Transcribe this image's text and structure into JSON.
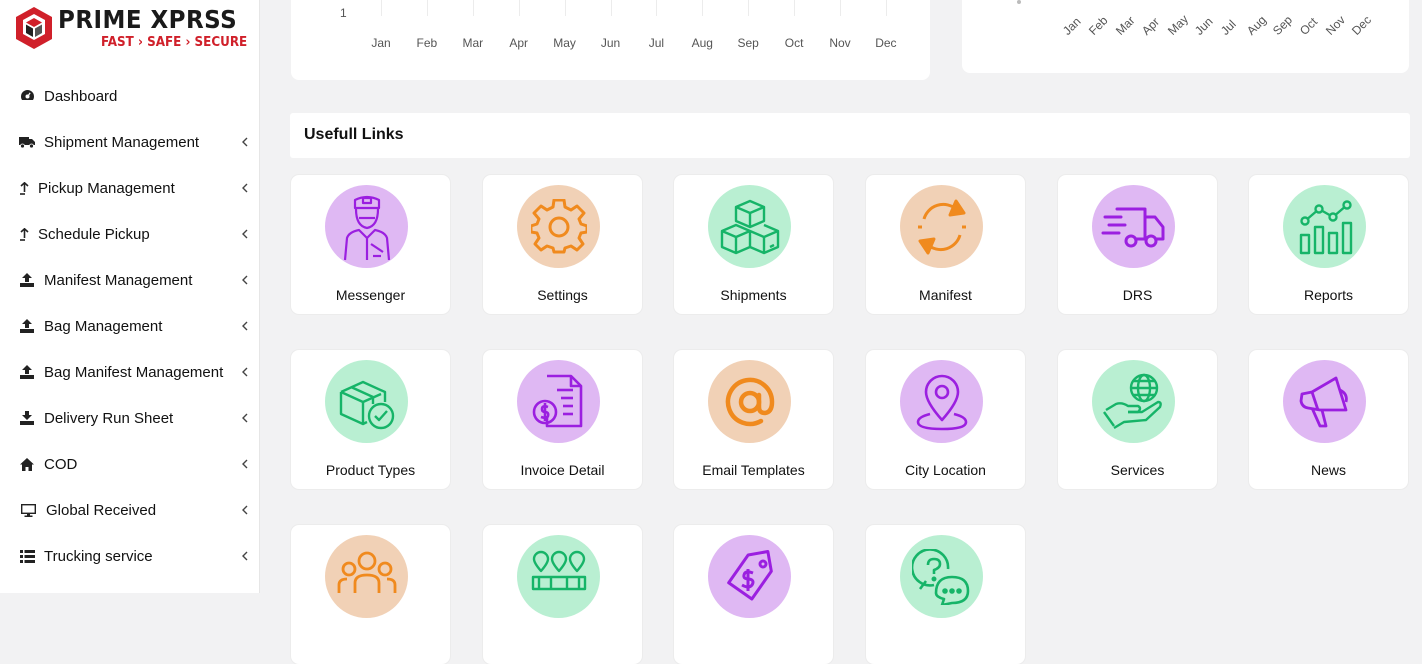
{
  "brand": {
    "name": "PRIME XPRSS",
    "tagline": "FAST › SAFE › SECURE"
  },
  "sidebar": {
    "items": [
      {
        "label": "Dashboard",
        "icon": "dashboard-icon",
        "has_children": false
      },
      {
        "label": "Shipment Management",
        "icon": "truck-icon",
        "has_children": true
      },
      {
        "label": "Pickup Management",
        "icon": "arrow-up-icon",
        "has_children": true
      },
      {
        "label": "Schedule Pickup",
        "icon": "arrow-up-icon",
        "has_children": true
      },
      {
        "label": "Manifest Management",
        "icon": "upload-icon",
        "has_children": true
      },
      {
        "label": "Bag Management",
        "icon": "upload-icon",
        "has_children": true
      },
      {
        "label": "Bag Manifest Management",
        "icon": "upload-icon",
        "has_children": true
      },
      {
        "label": "Delivery Run Sheet",
        "icon": "download-icon",
        "has_children": true
      },
      {
        "label": "COD",
        "icon": "home-icon",
        "has_children": true
      },
      {
        "label": "Global Received",
        "icon": "desktop-icon",
        "has_children": true
      },
      {
        "label": "Trucking service",
        "icon": "list-icon",
        "has_children": true
      }
    ]
  },
  "chart_left": {
    "y_tick": "1",
    "months": [
      "Jan",
      "Feb",
      "Mar",
      "Apr",
      "May",
      "Jun",
      "Jul",
      "Aug",
      "Sep",
      "Oct",
      "Nov",
      "Dec"
    ]
  },
  "chart_right": {
    "months": [
      "Jan",
      "Feb",
      "Mar",
      "Apr",
      "May",
      "Jun",
      "Jul",
      "Aug",
      "Sep",
      "Oct",
      "Nov",
      "Dec"
    ]
  },
  "links": {
    "title": "Usefull Links",
    "tiles": [
      {
        "label": "Messenger",
        "icon": "messenger-icon",
        "color": "purple"
      },
      {
        "label": "Settings",
        "icon": "gear-icon",
        "color": "peach"
      },
      {
        "label": "Shipments",
        "icon": "boxes-icon",
        "color": "mint"
      },
      {
        "label": "Manifest",
        "icon": "refresh-icon",
        "color": "peach"
      },
      {
        "label": "DRS",
        "icon": "delivery-truck-icon",
        "color": "purple"
      },
      {
        "label": "Reports",
        "icon": "chart-icon",
        "color": "mint"
      },
      {
        "label": "Product Types",
        "icon": "package-check-icon",
        "color": "mint"
      },
      {
        "label": "Invoice Detail",
        "icon": "invoice-icon",
        "color": "purple"
      },
      {
        "label": "Email Templates",
        "icon": "at-icon",
        "color": "peach"
      },
      {
        "label": "City Location",
        "icon": "map-pin-icon",
        "color": "purple"
      },
      {
        "label": "Services",
        "icon": "globe-hand-icon",
        "color": "mint"
      },
      {
        "label": "News",
        "icon": "megaphone-icon",
        "color": "purple"
      },
      {
        "label": "",
        "icon": "users-icon",
        "color": "peach"
      },
      {
        "label": "",
        "icon": "locations-icon",
        "color": "mint"
      },
      {
        "label": "",
        "icon": "price-tag-icon",
        "color": "purple"
      },
      {
        "label": "",
        "icon": "chat-question-icon",
        "color": "mint"
      }
    ]
  },
  "colors": {
    "brand_red": "#d0202a",
    "icon_purple": "#9b1fe0",
    "icon_orange": "#f08a1e",
    "icon_green": "#16b468"
  }
}
